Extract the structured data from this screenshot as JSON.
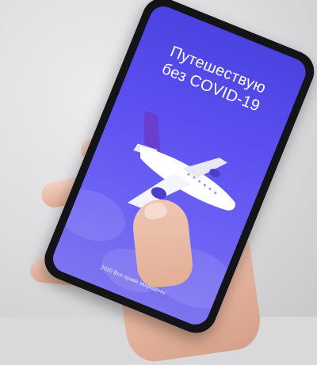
{
  "screen": {
    "title_line1": "Путешествую",
    "title_line2": "без COVID-19",
    "footer": "2020 Все права защищены"
  },
  "colors": {
    "screen_top": "#4a43e0",
    "screen_bottom": "#7d74f0",
    "plane_tail": "#6a3fd0",
    "plane_body": "#ffffff"
  },
  "icons": {
    "hero_graphic": "airplane-icon"
  }
}
